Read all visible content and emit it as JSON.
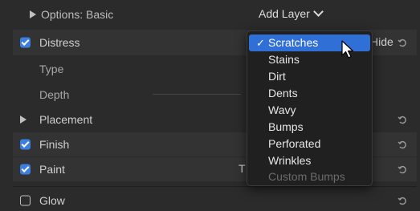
{
  "options_label": "Options: Basic",
  "add_layer_label": "Add Layer",
  "rows": {
    "distress": "Distress",
    "type": "Type",
    "depth": "Depth",
    "placement": "Placement",
    "finish": "Finish",
    "paint": "Paint",
    "glow": "Glow"
  },
  "hide_label": "Hide",
  "paint_value_fragment": "T",
  "menu": {
    "items": [
      "Scratches",
      "Stains",
      "Dirt",
      "Dents",
      "Wavy",
      "Bumps",
      "Perforated",
      "Wrinkles",
      "Custom Bumps"
    ],
    "selected_check": "✓"
  },
  "colors": {
    "accent": "#3c7fe0",
    "menu_highlight": "#2f6fd6"
  }
}
